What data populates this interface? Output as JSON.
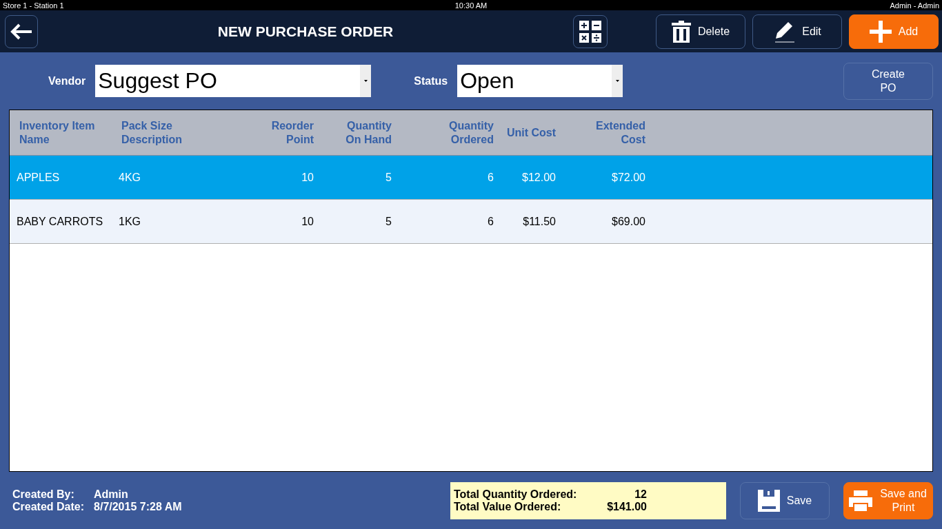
{
  "status_bar": {
    "left": "Store 1 - Station 1",
    "center": "10:30 AM",
    "right": "Admin - Admin"
  },
  "header": {
    "title": "NEW PURCHASE ORDER",
    "buttons": [
      {
        "kind": "delete",
        "label": "Delete"
      },
      {
        "kind": "edit",
        "label": "Edit"
      },
      {
        "kind": "add",
        "label": "Add"
      }
    ]
  },
  "filters": {
    "vendor": {
      "label": "Vendor",
      "value": "Suggest PO"
    },
    "status": {
      "label": "Status",
      "value": "Open"
    },
    "create_button": "Create PO"
  },
  "table": {
    "columns": [
      "Inventory Item Name",
      "Pack Size Description",
      "Reorder Point",
      "Quantity On Hand",
      "Quantity Ordered",
      "Unit Cost",
      "Extended Cost"
    ],
    "rows": [
      {
        "selected": true,
        "cells": [
          "APPLES",
          "4KG",
          "10",
          "5",
          "6",
          "$12.00",
          "$72.00"
        ]
      },
      {
        "selected": false,
        "cells": [
          "BABY CARROTS",
          "1KG",
          "10",
          "5",
          "6",
          "$11.50",
          "$69.00"
        ]
      }
    ]
  },
  "footer": {
    "created_by_label": "Created By:",
    "created_by": "Admin",
    "created_date_label": "Created Date:",
    "created_date": "8/7/2015 7:28 AM",
    "totals": [
      {
        "label": "Total Quantity Ordered:",
        "value": "12"
      },
      {
        "label": "Total Value Ordered:",
        "value": "$141.00"
      }
    ],
    "buttons": [
      {
        "kind": "save",
        "label": "Save"
      },
      {
        "kind": "print",
        "label": "Save and Print"
      }
    ]
  }
}
